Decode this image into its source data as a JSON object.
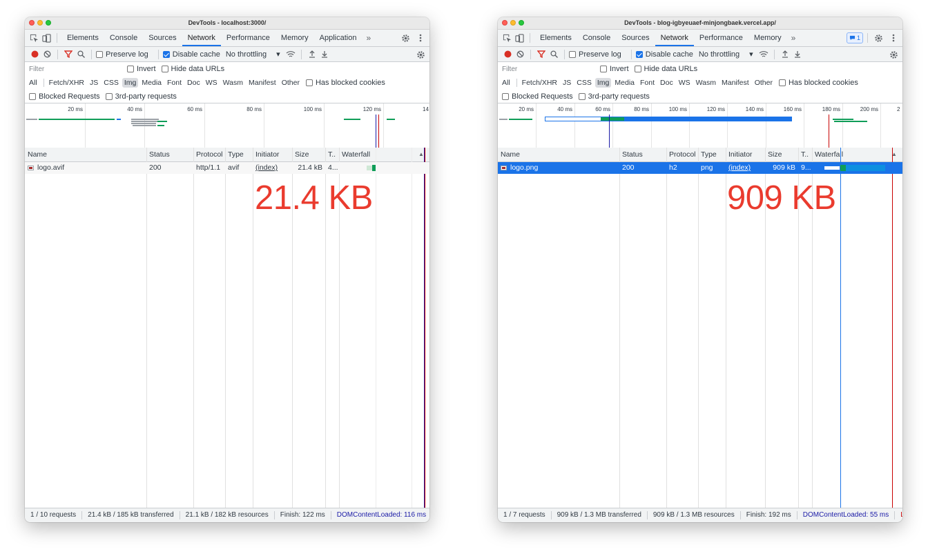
{
  "left": {
    "title": "DevTools - localhost:3000/",
    "tabs": [
      "Elements",
      "Console",
      "Sources",
      "Network",
      "Performance",
      "Memory",
      "Application"
    ],
    "active_tab": "Network",
    "more_tabs": "»",
    "toolbar": {
      "preserve_log": "Preserve log",
      "disable_cache": "Disable cache",
      "throttling": "No throttling"
    },
    "filter": {
      "placeholder": "Filter",
      "invert": "Invert",
      "hide_data_urls": "Hide data URLs"
    },
    "types": [
      "All",
      "Fetch/XHR",
      "JS",
      "CSS",
      "Img",
      "Media",
      "Font",
      "Doc",
      "WS",
      "Wasm",
      "Manifest",
      "Other"
    ],
    "active_type": "Img",
    "has_blocked_cookies": "Has blocked cookies",
    "blocked_requests": "Blocked Requests",
    "third_party": "3rd-party requests",
    "overview_ticks": [
      "20 ms",
      "40 ms",
      "60 ms",
      "80 ms",
      "100 ms",
      "120 ms",
      "14"
    ],
    "columns": {
      "name": "Name",
      "status": "Status",
      "protocol": "Protocol",
      "type": "Type",
      "initiator": "Initiator",
      "size": "Size",
      "time": "T..",
      "waterfall": "Waterfall"
    },
    "row": {
      "name": "logo.avif",
      "status": "200",
      "protocol": "http/1.1",
      "type": "avif",
      "initiator": "(index)",
      "size": "21.4 kB",
      "time": "4..."
    },
    "annotation": "21.4 KB",
    "status_bar": {
      "requests": "1 / 10 requests",
      "transferred": "21.4 kB / 185 kB transferred",
      "resources": "21.1 kB / 182 kB resources",
      "finish": "Finish: 122 ms",
      "dcl": "DOMContentLoaded: 116 ms"
    }
  },
  "right": {
    "title": "DevTools - blog-igbyeuaef-minjongbaek.vercel.app/",
    "tabs": [
      "Elements",
      "Console",
      "Sources",
      "Network",
      "Performance",
      "Memory"
    ],
    "active_tab": "Network",
    "more_tabs": "»",
    "issues_count": "1",
    "toolbar": {
      "preserve_log": "Preserve log",
      "disable_cache": "Disable cache",
      "throttling": "No throttling"
    },
    "filter": {
      "placeholder": "Filter",
      "invert": "Invert",
      "hide_data_urls": "Hide data URLs"
    },
    "types": [
      "All",
      "Fetch/XHR",
      "JS",
      "CSS",
      "Img",
      "Media",
      "Font",
      "Doc",
      "WS",
      "Wasm",
      "Manifest",
      "Other"
    ],
    "active_type": "Img",
    "has_blocked_cookies": "Has blocked cookies",
    "blocked_requests": "Blocked Requests",
    "third_party": "3rd-party requests",
    "overview_ticks": [
      "20 ms",
      "40 ms",
      "60 ms",
      "80 ms",
      "100 ms",
      "120 ms",
      "140 ms",
      "160 ms",
      "180 ms",
      "200 ms",
      "2"
    ],
    "columns": {
      "name": "Name",
      "status": "Status",
      "protocol": "Protocol",
      "type": "Type",
      "initiator": "Initiator",
      "size": "Size",
      "time": "T..",
      "waterfall": "Waterfall"
    },
    "row": {
      "name": "logo.png",
      "status": "200",
      "protocol": "h2",
      "type": "png",
      "initiator": "(index)",
      "size": "909 kB",
      "time": "9..."
    },
    "annotation": "909 KB",
    "status_bar": {
      "requests": "1 / 7 requests",
      "transferred": "909 kB / 1.3 MB transferred",
      "resources": "909 kB / 1.3 MB resources",
      "finish": "Finish: 192 ms",
      "dcl": "DOMContentLoaded: 55 ms",
      "load": "Lo"
    }
  },
  "colors": {
    "accent": "#1a73e8",
    "annotation": "#ea3b2e",
    "record": "#d93025",
    "waterfall_green": "#0f9d58",
    "dcl_blue": "#1a1aa6",
    "load_red": "#c80000"
  }
}
